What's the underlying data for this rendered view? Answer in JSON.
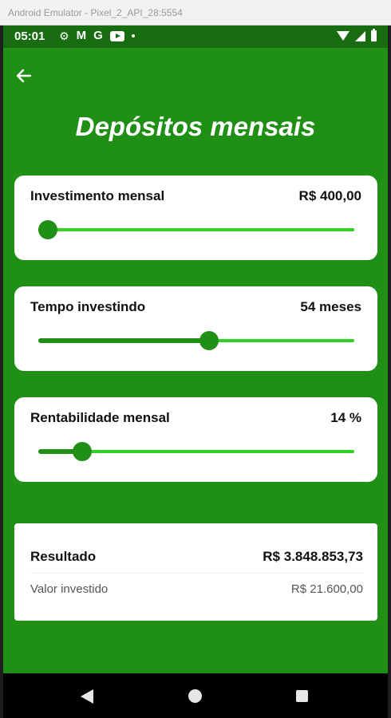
{
  "emulator": {
    "title": "Android Emulator - Pixel_2_API_28:5554"
  },
  "status_bar": {
    "time": "05:01",
    "left_icons": [
      "gear-icon",
      "gmail-icon",
      "google-icon",
      "youtube-icon",
      "dot-icon"
    ],
    "right_icons": [
      "wifi-icon",
      "signal-icon",
      "battery-icon"
    ]
  },
  "header": {
    "back_icon": "arrow-left-icon",
    "title": "Depósitos mensais"
  },
  "colors": {
    "background": "#1f8f16",
    "status_bar": "#176d10",
    "slider_active": "#1f8f16",
    "slider_inactive": "#2fd122",
    "card": "#ffffff"
  },
  "sliders": [
    {
      "label": "Investimento mensal",
      "value": "R$ 400,00",
      "position": 0.03
    },
    {
      "label": "Tempo investindo",
      "value": "54 meses",
      "position": 0.54
    },
    {
      "label": "Rentabilidade mensal",
      "value": "14 %",
      "position": 0.14
    }
  ],
  "result": {
    "label": "Resultado",
    "value": "R$ 3.848.853,73",
    "invested_label": "Valor investido",
    "invested_value": "R$ 21.600,00"
  },
  "nav_bar": {
    "icons": [
      "back-triangle-icon",
      "home-circle-icon",
      "recents-square-icon"
    ]
  }
}
